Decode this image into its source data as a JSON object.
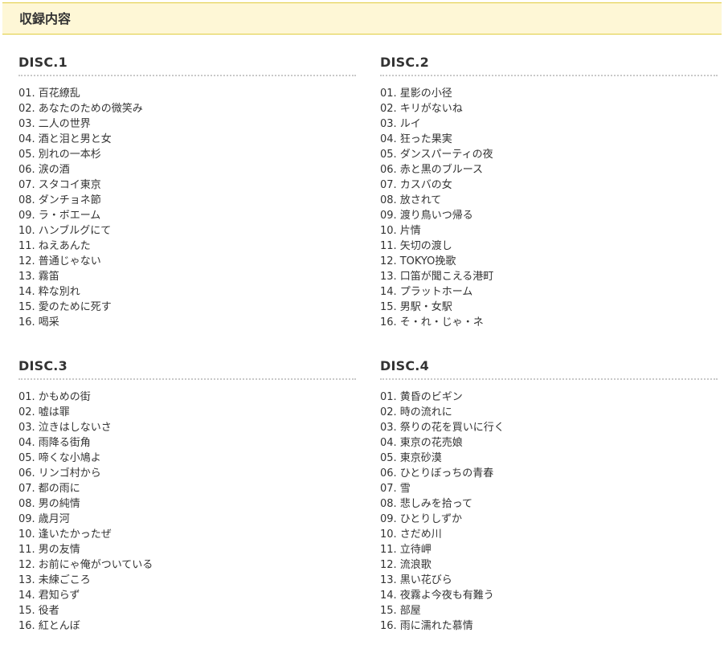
{
  "header": {
    "title": "収録内容"
  },
  "discs": [
    {
      "title": "DISC.1",
      "tracks": [
        {
          "num": "01.",
          "name": "百花繚乱"
        },
        {
          "num": "02.",
          "name": "あなたのための微笑み"
        },
        {
          "num": "03.",
          "name": "二人の世界"
        },
        {
          "num": "04.",
          "name": "酒と泪と男と女"
        },
        {
          "num": "05.",
          "name": "別れの一本杉"
        },
        {
          "num": "06.",
          "name": "涙の酒"
        },
        {
          "num": "07.",
          "name": "スタコイ東京"
        },
        {
          "num": "08.",
          "name": "ダンチョネ節"
        },
        {
          "num": "09.",
          "name": "ラ・ボエーム"
        },
        {
          "num": "10.",
          "name": "ハンブルグにて"
        },
        {
          "num": "11.",
          "name": "ねえあんた"
        },
        {
          "num": "12.",
          "name": "普通じゃない"
        },
        {
          "num": "13.",
          "name": "霧笛"
        },
        {
          "num": "14.",
          "name": "粋な別れ"
        },
        {
          "num": "15.",
          "name": "愛のために死す"
        },
        {
          "num": "16.",
          "name": "喝采"
        }
      ]
    },
    {
      "title": "DISC.2",
      "tracks": [
        {
          "num": "01.",
          "name": "星影の小径"
        },
        {
          "num": "02.",
          "name": "キリがないね"
        },
        {
          "num": "03.",
          "name": "ルイ"
        },
        {
          "num": "04.",
          "name": "狂った果実"
        },
        {
          "num": "05.",
          "name": "ダンスパーティの夜"
        },
        {
          "num": "06.",
          "name": "赤と黒のブルース"
        },
        {
          "num": "07.",
          "name": "カスバの女"
        },
        {
          "num": "08.",
          "name": "放されて"
        },
        {
          "num": "09.",
          "name": "渡り鳥いつ帰る"
        },
        {
          "num": "10.",
          "name": "片情"
        },
        {
          "num": "11.",
          "name": "矢切の渡し"
        },
        {
          "num": "12.",
          "name": "TOKYO挽歌"
        },
        {
          "num": "13.",
          "name": "口笛が聞こえる港町"
        },
        {
          "num": "14.",
          "name": "プラットホーム"
        },
        {
          "num": "15.",
          "name": "男駅・女駅"
        },
        {
          "num": "16.",
          "name": "そ・れ・じゃ・ネ"
        }
      ]
    },
    {
      "title": "DISC.3",
      "tracks": [
        {
          "num": "01.",
          "name": "かもめの街"
        },
        {
          "num": "02.",
          "name": "嘘は罪"
        },
        {
          "num": "03.",
          "name": "泣きはしないさ"
        },
        {
          "num": "04.",
          "name": "雨降る街角"
        },
        {
          "num": "05.",
          "name": "啼くな小鳩よ"
        },
        {
          "num": "06.",
          "name": "リンゴ村から"
        },
        {
          "num": "07.",
          "name": "都の雨に"
        },
        {
          "num": "08.",
          "name": "男の純情"
        },
        {
          "num": "09.",
          "name": "歳月河"
        },
        {
          "num": "10.",
          "name": "逢いたかったぜ"
        },
        {
          "num": "11.",
          "name": "男の友情"
        },
        {
          "num": "12.",
          "name": "お前にゃ俺がついている"
        },
        {
          "num": "13.",
          "name": "未練ごころ"
        },
        {
          "num": "14.",
          "name": "君知らず"
        },
        {
          "num": "15.",
          "name": "役者"
        },
        {
          "num": "16.",
          "name": "紅とんぼ"
        }
      ]
    },
    {
      "title": "DISC.4",
      "tracks": [
        {
          "num": "01.",
          "name": "黄昏のビギン"
        },
        {
          "num": "02.",
          "name": "時の流れに"
        },
        {
          "num": "03.",
          "name": "祭りの花を買いに行く"
        },
        {
          "num": "04.",
          "name": "東京の花売娘"
        },
        {
          "num": "05.",
          "name": "東京砂漠"
        },
        {
          "num": "06.",
          "name": "ひとりぼっちの青春"
        },
        {
          "num": "07.",
          "name": "雪"
        },
        {
          "num": "08.",
          "name": "悲しみを拾って"
        },
        {
          "num": "09.",
          "name": "ひとりしずか"
        },
        {
          "num": "10.",
          "name": "さだめ川"
        },
        {
          "num": "11.",
          "name": "立待岬"
        },
        {
          "num": "12.",
          "name": "流浪歌"
        },
        {
          "num": "13.",
          "name": "黒い花びら"
        },
        {
          "num": "14.",
          "name": "夜霧よ今夜も有難う"
        },
        {
          "num": "15.",
          "name": "部屋"
        },
        {
          "num": "16.",
          "name": "雨に濡れた慕情"
        }
      ]
    }
  ],
  "colors": {
    "header_bg": "#fef7d6",
    "header_border": "#e1cd3f",
    "text": "#333333",
    "divider": "#c9c9c9"
  }
}
